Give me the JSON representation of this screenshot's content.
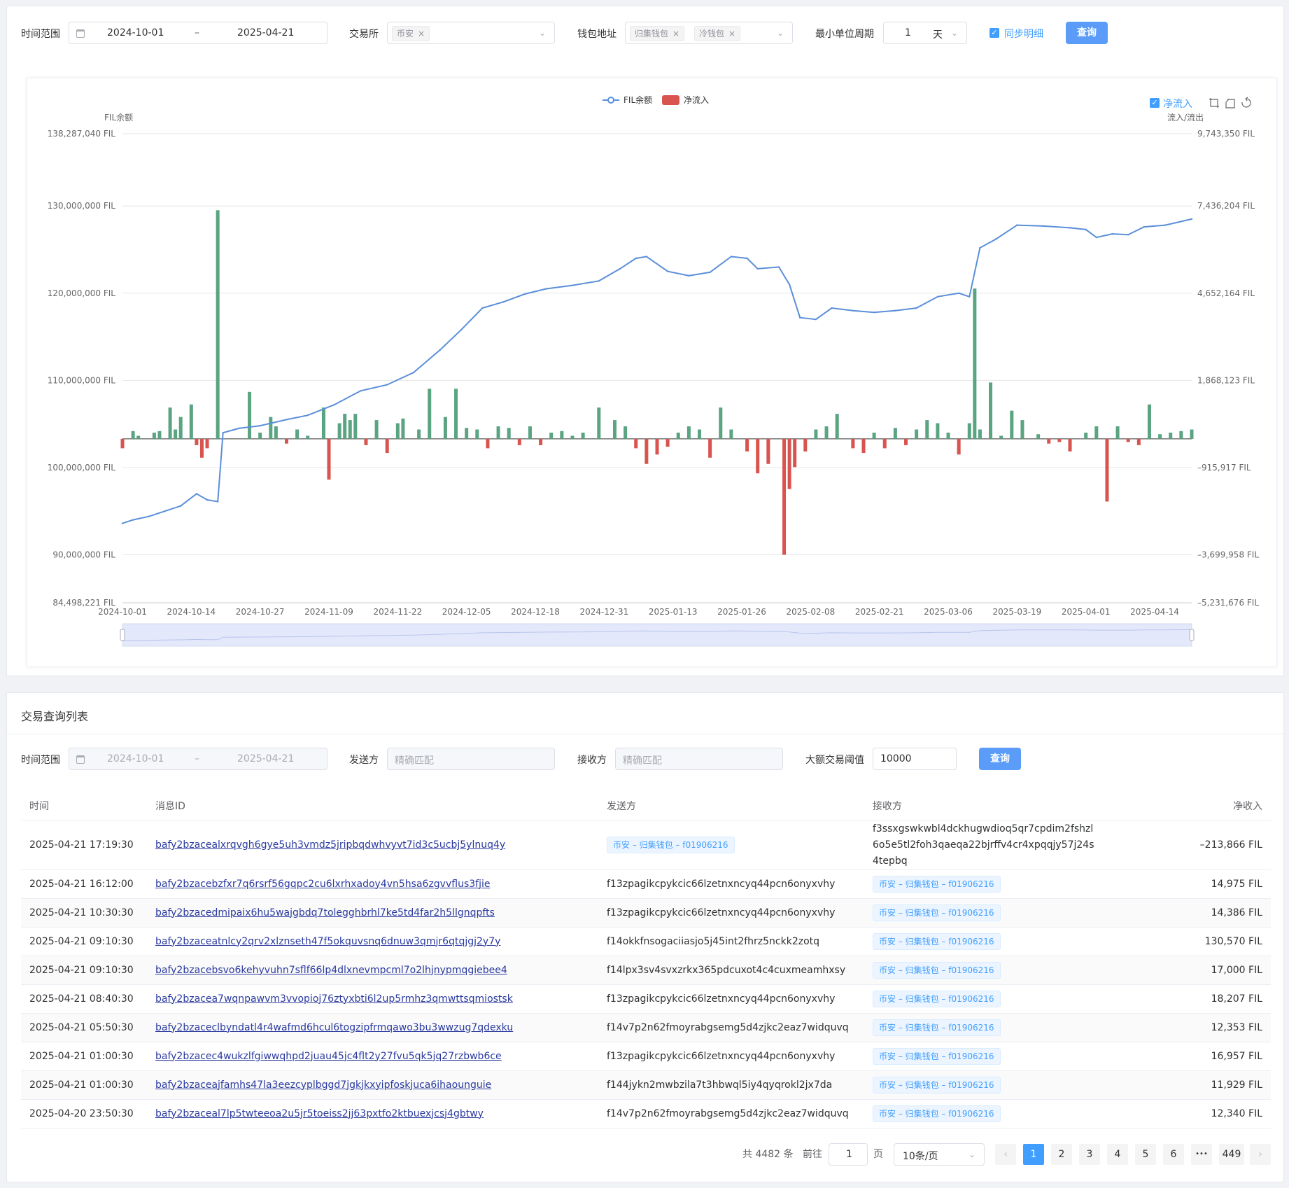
{
  "filters": {
    "time_label": "时间范围",
    "date_start": "2024-10-01",
    "date_sep": "–",
    "date_end": "2025-04-21",
    "exchange_label": "交易所",
    "exchange_tag": "币安",
    "wallet_label": "钱包地址",
    "wallet_tags": [
      "归集钱包",
      "冷钱包"
    ],
    "period_label": "最小单位周期",
    "period_value": "1",
    "period_unit": "天",
    "sync_label": "同步明细",
    "query_label": "查询",
    "tag_close": "×"
  },
  "chart_toolbar": {
    "netflow_toggle": "净流入"
  },
  "chart_data": {
    "type": "line",
    "legend": [
      "FIL余额",
      "净流入"
    ],
    "legend_position": "top-center",
    "y_left_title": "FIL余额",
    "y_right_title": "流入/流出",
    "y_left_ticks": [
      "138,287,040 FIL",
      "130,000,000 FIL",
      "120,000,000 FIL",
      "110,000,000 FIL",
      "100,000,000 FIL",
      "90,000,000 FIL",
      "84,498,221 FIL"
    ],
    "y_left_values": [
      138287040,
      130000000,
      120000000,
      110000000,
      100000000,
      90000000,
      84498221
    ],
    "y_right_ticks": [
      "9,743,350 FIL",
      "7,436,204 FIL",
      "4,652,164 FIL",
      "1,868,123 FIL",
      "–915,917 FIL",
      "–3,699,958 FIL",
      "–5,231,676 FIL"
    ],
    "ylim_left": [
      84498221,
      138287040
    ],
    "ylim_right": [
      -5231676,
      9743350
    ],
    "x_ticks": [
      "2024-10-01",
      "2024-10-14",
      "2024-10-27",
      "2024-11-09",
      "2024-11-22",
      "2024-12-05",
      "2024-12-18",
      "2024-12-31",
      "2025-01-13",
      "2025-01-26",
      "2025-02-08",
      "2025-02-21",
      "2025-03-06",
      "2025-03-19",
      "2025-04-01",
      "2025-04-14"
    ],
    "x_range": [
      "2024-10-01",
      "2025-04-21"
    ],
    "grid": true,
    "balance_series": {
      "name": "FIL余额",
      "color": "#5b8fd9",
      "points": [
        [
          "2024-10-01",
          93600000
        ],
        [
          "2024-10-03",
          94000000
        ],
        [
          "2024-10-06",
          94400000
        ],
        [
          "2024-10-09",
          95000000
        ],
        [
          "2024-10-12",
          95600000
        ],
        [
          "2024-10-15",
          97000000
        ],
        [
          "2024-10-17",
          96300000
        ],
        [
          "2024-10-19",
          96100000
        ],
        [
          "2024-10-20",
          104000000
        ],
        [
          "2024-10-23",
          104500000
        ],
        [
          "2024-10-27",
          104800000
        ],
        [
          "2024-11-01",
          105500000
        ],
        [
          "2024-11-05",
          106000000
        ],
        [
          "2024-11-10",
          107200000
        ],
        [
          "2024-11-15",
          108800000
        ],
        [
          "2024-11-20",
          109500000
        ],
        [
          "2024-11-25",
          110900000
        ],
        [
          "2024-11-30",
          113500000
        ],
        [
          "2024-12-04",
          115800000
        ],
        [
          "2024-12-08",
          118300000
        ],
        [
          "2024-12-12",
          119000000
        ],
        [
          "2024-12-16",
          119900000
        ],
        [
          "2024-12-20",
          120500000
        ],
        [
          "2024-12-25",
          120900000
        ],
        [
          "2024-12-30",
          121400000
        ],
        [
          "2025-01-03",
          122800000
        ],
        [
          "2025-01-06",
          124000000
        ],
        [
          "2025-01-08",
          124200000
        ],
        [
          "2025-01-12",
          122500000
        ],
        [
          "2025-01-16",
          122000000
        ],
        [
          "2025-01-20",
          122400000
        ],
        [
          "2025-01-24",
          124200000
        ],
        [
          "2025-01-27",
          124000000
        ],
        [
          "2025-01-29",
          122800000
        ],
        [
          "2025-02-02",
          123000000
        ],
        [
          "2025-02-04",
          121000000
        ],
        [
          "2025-02-06",
          117200000
        ],
        [
          "2025-02-09",
          117000000
        ],
        [
          "2025-02-12",
          118300000
        ],
        [
          "2025-02-16",
          118000000
        ],
        [
          "2025-02-20",
          117800000
        ],
        [
          "2025-02-24",
          118000000
        ],
        [
          "2025-02-28",
          118300000
        ],
        [
          "2025-03-04",
          119600000
        ],
        [
          "2025-03-08",
          120000000
        ],
        [
          "2025-03-10",
          119600000
        ],
        [
          "2025-03-12",
          125200000
        ],
        [
          "2025-03-15",
          126200000
        ],
        [
          "2025-03-19",
          127800000
        ],
        [
          "2025-03-24",
          127700000
        ],
        [
          "2025-03-29",
          127500000
        ],
        [
          "2025-04-01",
          127300000
        ],
        [
          "2025-04-03",
          126400000
        ],
        [
          "2025-04-06",
          126800000
        ],
        [
          "2025-04-09",
          126700000
        ],
        [
          "2025-04-12",
          127600000
        ],
        [
          "2025-04-16",
          127800000
        ],
        [
          "2025-04-21",
          128500000
        ]
      ]
    },
    "netflow_series": {
      "name": "净流入",
      "color_positive": "#5aa482",
      "color_negative": "#d9534f",
      "bars": [
        [
          "2024-10-01",
          -300000
        ],
        [
          "2024-10-03",
          250000
        ],
        [
          "2024-10-04",
          100000
        ],
        [
          "2024-10-07",
          200000
        ],
        [
          "2024-10-08",
          250000
        ],
        [
          "2024-10-10",
          1000000
        ],
        [
          "2024-10-11",
          300000
        ],
        [
          "2024-10-12",
          700000
        ],
        [
          "2024-10-14",
          1100000
        ],
        [
          "2024-10-15",
          -200000
        ],
        [
          "2024-10-16",
          -600000
        ],
        [
          "2024-10-17",
          -300000
        ],
        [
          "2024-10-19",
          7300000
        ],
        [
          "2024-10-25",
          1500000
        ],
        [
          "2024-10-27",
          200000
        ],
        [
          "2024-10-29",
          700000
        ],
        [
          "2024-10-30",
          400000
        ],
        [
          "2024-11-01",
          -150000
        ],
        [
          "2024-11-03",
          300000
        ],
        [
          "2024-11-05",
          100000
        ],
        [
          "2024-11-08",
          1000000
        ],
        [
          "2024-11-09",
          -1300000
        ],
        [
          "2024-11-11",
          500000
        ],
        [
          "2024-11-12",
          800000
        ],
        [
          "2024-11-13",
          600000
        ],
        [
          "2024-11-14",
          800000
        ],
        [
          "2024-11-16",
          -200000
        ],
        [
          "2024-11-18",
          600000
        ],
        [
          "2024-11-20",
          -450000
        ],
        [
          "2024-11-22",
          500000
        ],
        [
          "2024-11-23",
          650000
        ],
        [
          "2024-11-26",
          300000
        ],
        [
          "2024-11-28",
          1600000
        ],
        [
          "2024-12-01",
          700000
        ],
        [
          "2024-12-03",
          1600000
        ],
        [
          "2024-12-05",
          350000
        ],
        [
          "2024-12-07",
          300000
        ],
        [
          "2024-12-09",
          -300000
        ],
        [
          "2024-12-11",
          400000
        ],
        [
          "2024-12-13",
          350000
        ],
        [
          "2024-12-15",
          -200000
        ],
        [
          "2024-12-17",
          400000
        ],
        [
          "2024-12-19",
          -200000
        ],
        [
          "2024-12-21",
          200000
        ],
        [
          "2024-12-23",
          250000
        ],
        [
          "2024-12-25",
          100000
        ],
        [
          "2024-12-27",
          200000
        ],
        [
          "2024-12-30",
          1000000
        ],
        [
          "2025-01-02",
          600000
        ],
        [
          "2025-01-04",
          400000
        ],
        [
          "2025-01-06",
          -300000
        ],
        [
          "2025-01-08",
          -800000
        ],
        [
          "2025-01-10",
          -500000
        ],
        [
          "2025-01-12",
          -250000
        ],
        [
          "2025-01-14",
          200000
        ],
        [
          "2025-01-16",
          400000
        ],
        [
          "2025-01-18",
          300000
        ],
        [
          "2025-01-20",
          -600000
        ],
        [
          "2025-01-22",
          1000000
        ],
        [
          "2025-01-24",
          300000
        ],
        [
          "2025-01-27",
          -400000
        ],
        [
          "2025-01-29",
          -1100000
        ],
        [
          "2025-01-31",
          -800000
        ],
        [
          "2025-02-03",
          -3700000
        ],
        [
          "2025-02-04",
          -1600000
        ],
        [
          "2025-02-05",
          -900000
        ],
        [
          "2025-02-07",
          -400000
        ],
        [
          "2025-02-09",
          300000
        ],
        [
          "2025-02-11",
          400000
        ],
        [
          "2025-02-13",
          800000
        ],
        [
          "2025-02-16",
          -300000
        ],
        [
          "2025-02-18",
          -450000
        ],
        [
          "2025-02-20",
          200000
        ],
        [
          "2025-02-22",
          -300000
        ],
        [
          "2025-02-24",
          350000
        ],
        [
          "2025-02-26",
          -200000
        ],
        [
          "2025-02-28",
          300000
        ],
        [
          "2025-03-02",
          600000
        ],
        [
          "2025-03-04",
          500000
        ],
        [
          "2025-03-06",
          200000
        ],
        [
          "2025-03-08",
          -500000
        ],
        [
          "2025-03-10",
          500000
        ],
        [
          "2025-03-11",
          4800000
        ],
        [
          "2025-03-12",
          300000
        ],
        [
          "2025-03-14",
          1800000
        ],
        [
          "2025-03-16",
          100000
        ],
        [
          "2025-03-18",
          900000
        ],
        [
          "2025-03-20",
          600000
        ],
        [
          "2025-03-23",
          150000
        ],
        [
          "2025-03-25",
          -150000
        ],
        [
          "2025-03-27",
          -100000
        ],
        [
          "2025-03-29",
          -400000
        ],
        [
          "2025-04-01",
          200000
        ],
        [
          "2025-04-03",
          400000
        ],
        [
          "2025-04-05",
          -2000000
        ],
        [
          "2025-04-07",
          400000
        ],
        [
          "2025-04-09",
          -100000
        ],
        [
          "2025-04-11",
          -200000
        ],
        [
          "2025-04-13",
          1100000
        ],
        [
          "2025-04-15",
          150000
        ],
        [
          "2025-04-17",
          200000
        ],
        [
          "2025-04-19",
          250000
        ],
        [
          "2025-04-21",
          300000
        ]
      ]
    }
  },
  "list": {
    "title": "交易查询列表",
    "time_label": "时间范围",
    "date_start": "2024-10-01",
    "date_sep": "–",
    "date_end": "2025-04-21",
    "sender_label": "发送方",
    "sender_placeholder": "精确匹配",
    "receiver_label": "接收方",
    "receiver_placeholder": "精确匹配",
    "threshold_label": "大额交易阈值",
    "threshold_value": "10000",
    "query_label": "查询",
    "columns": [
      "时间",
      "消息ID",
      "发送方",
      "接收方",
      "净收入"
    ],
    "rows": [
      {
        "time": "2025-04-21 17:19:30",
        "msg": "bafy2bzacealxrqvgh6gye5uh3vmdz5jripbqdwhvyvt7id3c5ucbj5ylnuq4y",
        "from": "币安 – 归集钱包 – f01906216",
        "from_tag": true,
        "to": "f3ssxgswkwbl4dckhugwdioq5qr7cpdim2fshzl6o5e5tl2foh3qaeqa22bjrffv4cr4xpqqjy57j24s4tepbq",
        "to_tag": false,
        "net": "–213,866 FIL"
      },
      {
        "time": "2025-04-21 16:12:00",
        "msg": "bafy2bzacebzfxr7q6rsrf56gqpc2cu6lxrhxadoy4vn5hsa6zgvvflus3fjie",
        "from": "f13zpagikcpykcic66lzetnxncyq44pcn6onyxvhy",
        "from_tag": false,
        "to": "币安 – 归集钱包 – f01906216",
        "to_tag": true,
        "net": "14,975 FIL"
      },
      {
        "time": "2025-04-21 10:30:30",
        "msg": "bafy2bzacedmipaix6hu5wajgbdq7tolegghbrhl7ke5td4far2h5llgnqpfts",
        "from": "f13zpagikcpykcic66lzetnxncyq44pcn6onyxvhy",
        "from_tag": false,
        "to": "币安 – 归集钱包 – f01906216",
        "to_tag": true,
        "net": "14,386 FIL"
      },
      {
        "time": "2025-04-21 09:10:30",
        "msg": "bafy2bzaceatnlcy2qrv2xlznseth47f5okquvsnq6dnuw3qmjr6qtqjgj2y7y",
        "from": "f14okkfnsogaciiasjo5j45int2fhrz5nckk2zotq",
        "from_tag": false,
        "to": "币安 – 归集钱包 – f01906216",
        "to_tag": true,
        "net": "130,570 FIL"
      },
      {
        "time": "2025-04-21 09:10:30",
        "msg": "bafy2bzacebsvo6kehyvuhn7sflf66lp4dlxnevmpcml7o2lhjnypmqgiebee4",
        "from": "f14lpx3sv4svxzrkx365pdcuxot4c4cuxmeamhxsy",
        "from_tag": false,
        "to": "币安 – 归集钱包 – f01906216",
        "to_tag": true,
        "net": "17,000 FIL"
      },
      {
        "time": "2025-04-21 08:40:30",
        "msg": "bafy2bzacea7wqnpawvm3vvopioj76ztyxbti6l2up5rmhz3qmwttsqmiostsk",
        "from": "f13zpagikcpykcic66lzetnxncyq44pcn6onyxvhy",
        "from_tag": false,
        "to": "币安 – 归集钱包 – f01906216",
        "to_tag": true,
        "net": "18,207 FIL"
      },
      {
        "time": "2025-04-21 05:50:30",
        "msg": "bafy2bzaceclbyndatl4r4wafmd6hcul6togzipfrmqawo3bu3wwzug7qdexku",
        "from": "f14v7p2n62fmoyrabgsemg5d4zjkc2eaz7widquvq",
        "from_tag": false,
        "to": "币安 – 归集钱包 – f01906216",
        "to_tag": true,
        "net": "12,353 FIL"
      },
      {
        "time": "2025-04-21 01:00:30",
        "msg": "bafy2bzacec4wukzlfgiwwqhpd2juau45jc4flt2y27fvu5qk5jq27rzbwb6ce",
        "from": "f13zpagikcpykcic66lzetnxncyq44pcn6onyxvhy",
        "from_tag": false,
        "to": "币安 – 归集钱包 – f01906216",
        "to_tag": true,
        "net": "16,957 FIL"
      },
      {
        "time": "2025-04-21 01:00:30",
        "msg": "bafy2bzaceajfamhs47la3eezcyplbggd7jgkjkxyipfoskjuca6ihaounguie",
        "from": "f144jykn2mwbzila7t3hbwql5iy4qyqrokl2jx7da",
        "from_tag": false,
        "to": "币安 – 归集钱包 – f01906216",
        "to_tag": true,
        "net": "11,929 FIL"
      },
      {
        "time": "2025-04-20 23:50:30",
        "msg": "bafy2bzaceal7lp5twteeoa2u5jr5toeiss2jj63pxtfo2ktbuexjcsj4gbtwy",
        "from": "f14v7p2n62fmoyrabgsemg5d4zjkc2eaz7widquvq",
        "from_tag": false,
        "to": "币安 – 归集钱包 – f01906216",
        "to_tag": true,
        "net": "12,340 FIL"
      }
    ]
  },
  "pagination": {
    "total": "共 4482 条",
    "goto_label": "前往",
    "goto_value": "1",
    "page_unit": "页",
    "page_size": "10条/页",
    "prev": "‹",
    "next": "›",
    "pages": [
      "1",
      "2",
      "3",
      "4",
      "5",
      "6"
    ],
    "ellipsis": "•••",
    "last_page": "449",
    "current": "1"
  }
}
